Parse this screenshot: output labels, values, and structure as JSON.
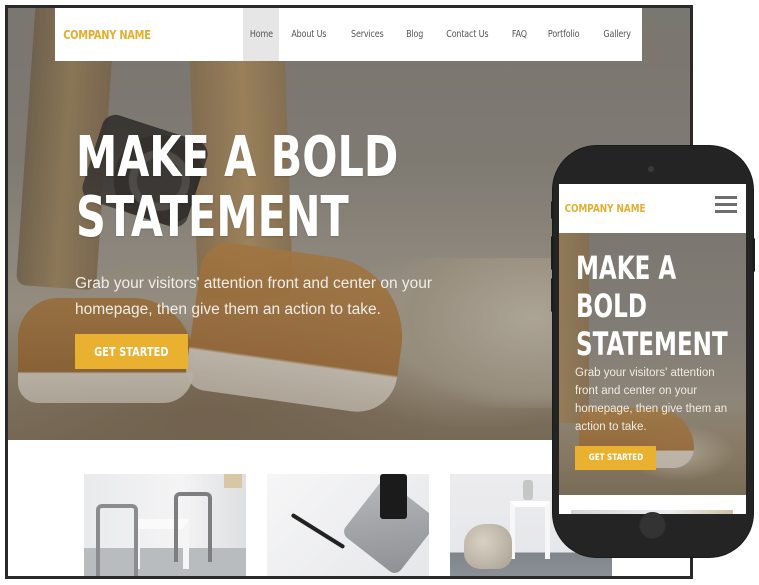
{
  "desktop": {
    "brand": "COMPANY NAME",
    "nav": [
      {
        "label": "Home",
        "active": true
      },
      {
        "label": "About Us",
        "active": false
      },
      {
        "label": "Services",
        "active": false
      },
      {
        "label": "Blog",
        "active": false
      },
      {
        "label": "Contact Us",
        "active": false
      },
      {
        "label": "FAQ",
        "active": false
      },
      {
        "label": "Portfolio",
        "active": false
      },
      {
        "label": "Gallery",
        "active": false
      }
    ],
    "hero": {
      "title_line1": "MAKE A BOLD",
      "title_line2": "STATEMENT",
      "subtitle": "Grab your visitors' attention front and center on your homepage, then give them an action to take.",
      "cta_label": "GET STARTED"
    },
    "gallery": [
      {
        "alt": "dining chairs and table"
      },
      {
        "alt": "pen, tablet and phone on desk"
      },
      {
        "alt": "blanket and side table"
      }
    ]
  },
  "mobile": {
    "brand": "COMPANY NAME",
    "menu_icon": "hamburger-icon",
    "hero": {
      "title_line1": "MAKE A",
      "title_line2": "BOLD",
      "title_line3": "STATEMENT",
      "subtitle": "Grab your visitors' attention front and center on your homepage, then give them an action to take.",
      "cta_label": "GET STARTED"
    }
  },
  "colors": {
    "accent": "#e9b12f",
    "brand_text": "#e3ae2e",
    "nav_active_bg": "#e6e6e6",
    "frame": "#2a2a2a",
    "phone_body": "#242424"
  }
}
